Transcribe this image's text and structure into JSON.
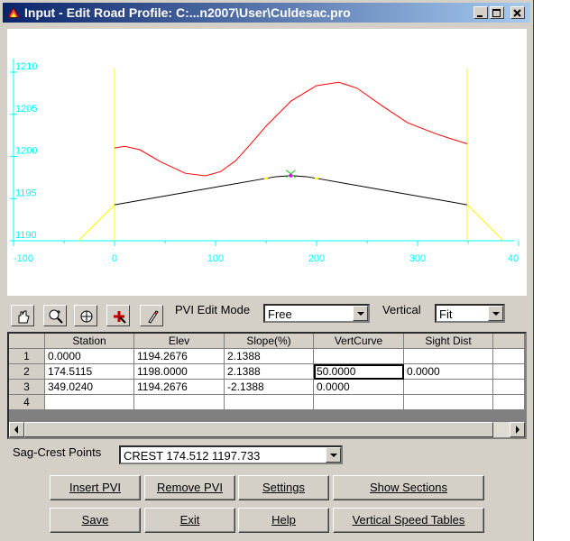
{
  "window": {
    "title": "Input - Edit Road Profile: C:...n2007\\User\\Culdesac.pro"
  },
  "chart_data": {
    "type": "line",
    "x_ticks": [
      "-100",
      "0",
      "100",
      "200",
      "300",
      "40"
    ],
    "y_ticks": [
      "1190",
      "1195",
      "1200",
      "1205",
      "1210"
    ],
    "xlim": [
      -100,
      400
    ],
    "ylim": [
      1190,
      1211.5
    ],
    "series": [
      {
        "role": "ground",
        "color": "#ff0000",
        "x": [
          0,
          10,
          25,
          45,
          70,
          90,
          105,
          120,
          135,
          150,
          175,
          200,
          222,
          240,
          265,
          290,
          320,
          349
        ],
        "y": [
          1201.0,
          1201.2,
          1200.8,
          1199.4,
          1198.0,
          1197.7,
          1198.2,
          1199.5,
          1201.5,
          1203.6,
          1206.6,
          1208.4,
          1208.8,
          1208.1,
          1206.0,
          1204.0,
          1202.6,
          1201.5
        ]
      },
      {
        "role": "grade",
        "color": "#000000",
        "x": [
          0,
          150,
          160,
          174.5,
          190,
          200,
          349
        ],
        "y": [
          1194.27,
          1197.4,
          1197.6,
          1197.73,
          1197.6,
          1197.4,
          1194.27
        ]
      },
      {
        "role": "extension",
        "color": "#ffff00",
        "x": [
          -35,
          0
        ],
        "y": [
          1190.1,
          1194.27
        ]
      },
      {
        "role": "extension",
        "color": "#ffff00",
        "x": [
          349,
          384
        ],
        "y": [
          1194.27,
          1190.1
        ]
      }
    ],
    "verticals": [
      0,
      349
    ],
    "grid": false
  },
  "toolbar": {
    "tools": [
      "hand-icon",
      "zoom-in-icon",
      "zoom-window-icon",
      "pick-icon",
      "pencil-icon"
    ],
    "pvi_mode_label": "PVI Edit Mode",
    "pvi_mode_value": "Free",
    "vertical_label": "Vertical",
    "vertical_value": "Fit"
  },
  "table": {
    "columns": [
      "Station",
      "Elev",
      "Slope(%)",
      "VertCurve",
      "Sight Dist"
    ],
    "rows": [
      {
        "num": "1",
        "cells": [
          "0.0000",
          "1194.2676",
          "2.1388",
          "",
          ""
        ]
      },
      {
        "num": "2",
        "cells": [
          "174.5115",
          "1198.0000",
          "2.1388",
          "50.0000",
          "0.0000"
        ]
      },
      {
        "num": "3",
        "cells": [
          "349.0240",
          "1194.2676",
          "-2.1388",
          "0.0000",
          ""
        ]
      },
      {
        "num": "4",
        "cells": [
          "",
          "",
          "",
          "",
          ""
        ]
      }
    ]
  },
  "sag_crest": {
    "label": "Sag-Crest Points",
    "value": "CREST 174.512 1197.733"
  },
  "buttons": {
    "insert_pvi": "Insert PVI",
    "remove_pvi": "Remove PVI",
    "settings": "Settings",
    "show_sections": "Show Sections",
    "save": "Save",
    "exit": "Exit",
    "help": "Help",
    "vertical_speed_tables": "Vertical Speed Tables"
  }
}
